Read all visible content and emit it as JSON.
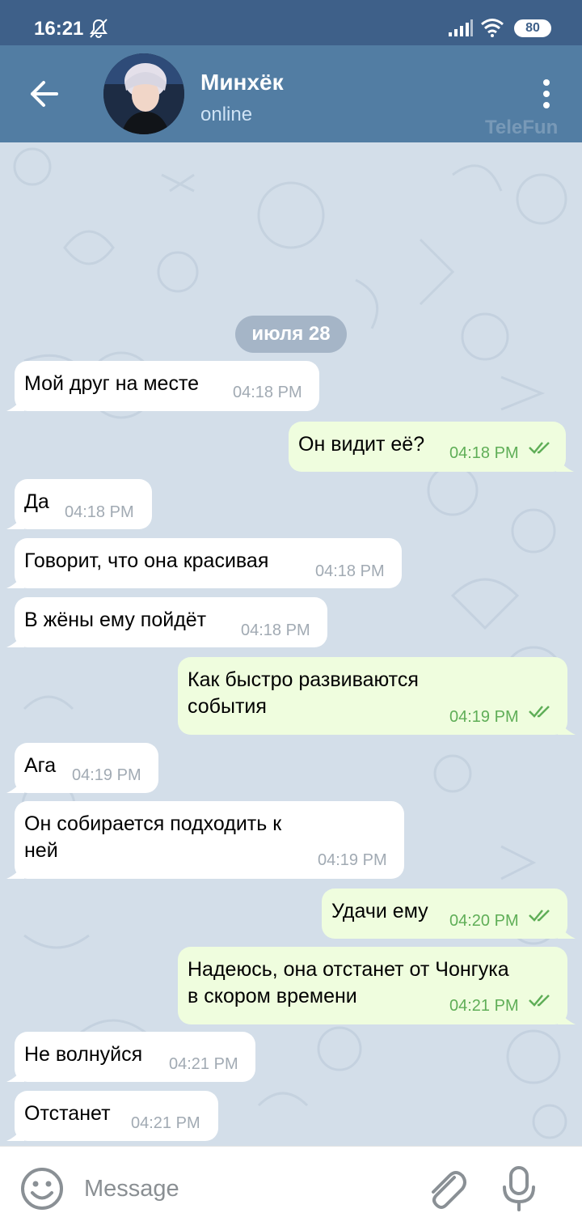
{
  "status_bar": {
    "time": "16:21",
    "battery": "80"
  },
  "header": {
    "name": "Минхёк",
    "status": "online",
    "watermark": "TeleFun"
  },
  "date_separator": "июля 28",
  "messages": [
    {
      "dir": "in",
      "text": "Мой друг на месте",
      "time": "04:18 PM"
    },
    {
      "dir": "out",
      "text": "Он видит её?",
      "time": "04:18 PM",
      "read": true
    },
    {
      "dir": "in",
      "text": "Да",
      "time": "04:18 PM"
    },
    {
      "dir": "in",
      "text": "Говорит, что она красивая",
      "time": "04:18 PM"
    },
    {
      "dir": "in",
      "text": "В жёны ему пойдёт",
      "time": "04:18 PM"
    },
    {
      "dir": "out",
      "text": "Как быстро развиваются\nсобытия",
      "time": "04:19 PM",
      "read": true
    },
    {
      "dir": "in",
      "text": "Ага",
      "time": "04:19 PM"
    },
    {
      "dir": "in",
      "text": "Он собирается подходить к\nней",
      "time": "04:19 PM"
    },
    {
      "dir": "out",
      "text": "Удачи ему",
      "time": "04:20 PM",
      "read": true
    },
    {
      "dir": "out",
      "text": "Надеюсь, она отстанет от Чонгука\nв скором времени",
      "time": "04:21 PM",
      "read": true
    },
    {
      "dir": "in",
      "text": "Не волнуйся",
      "time": "04:21 PM"
    },
    {
      "dir": "in",
      "text": "Отстанет",
      "time": "04:21 PM"
    }
  ],
  "composer": {
    "placeholder": "Message"
  },
  "colors": {
    "header": "#527da3",
    "status_bar": "#3e6089",
    "outgoing_bubble": "#effdde",
    "incoming_bubble": "#ffffff",
    "check": "#5fae57"
  },
  "icons": {
    "back": "arrow-left-icon",
    "menu": "more-vertical-icon",
    "emoji": "smile-icon",
    "attach": "paperclip-icon",
    "mic": "microphone-icon",
    "mute": "bell-off-icon"
  }
}
